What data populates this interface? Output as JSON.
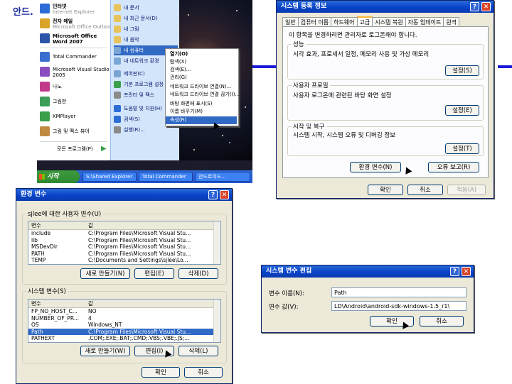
{
  "slide": {
    "title": "안드."
  },
  "start_menu": {
    "left_items": [
      {
        "label": "인터넷",
        "sub": "Internet Explorer",
        "color": "#2b6cd6"
      },
      {
        "label": "전자 메일",
        "sub": "Microsoft Office Outlook",
        "color": "#d9a427"
      },
      {
        "label": "Microsoft Office",
        "sub": "Word 2007",
        "color": "#2a55a8"
      },
      {
        "label": "Total Commander",
        "sub": "",
        "color": "#3a6fd0"
      },
      {
        "label": "Microsoft Visual Studio",
        "sub": "2005",
        "color": "#8a4ec0"
      },
      {
        "label": "나노",
        "sub": "",
        "color": "#c0398a"
      },
      {
        "label": "그림판",
        "sub": "",
        "color": "#3b9d58"
      },
      {
        "label": "KMPlayer",
        "sub": "",
        "color": "#3aa04a"
      },
      {
        "label": "그림 및 팩스 뷰어",
        "sub": "",
        "color": "#c08a40"
      }
    ],
    "all_programs": "모든 프로그램(P)",
    "right_items": [
      {
        "label": "내 문서",
        "color": "#e8c35a"
      },
      {
        "label": "내 최근 문서(D)",
        "color": "#e8c35a"
      },
      {
        "label": "내 그림",
        "color": "#e8c35a"
      },
      {
        "label": "내 음악",
        "color": "#e8c35a"
      },
      {
        "label": "내 컴퓨터",
        "color": "#7aa6d6"
      },
      {
        "label": "내 네트워크 환경",
        "color": "#7aa6d6"
      },
      {
        "label": "제어판(C)",
        "color": "#7aa6d6"
      },
      {
        "label": "기본 프로그램 설정",
        "color": "#3aa04a"
      },
      {
        "label": "프린터 및 팩스",
        "color": "#8a8a8a"
      },
      {
        "label": "도움말 및 지원(H)",
        "color": "#2b6cd6"
      },
      {
        "label": "검색(S)",
        "color": "#2b6cd6"
      },
      {
        "label": "실행(R)...",
        "color": "#8a8a8a"
      }
    ],
    "context_menu": [
      "열기(O)",
      "탐색(X)",
      "검색(E)...",
      "관리(G)",
      "네트워크 드라이브 연결(N)...",
      "네트워크 드라이브 연결 끊기(I)...",
      "바탕 화면에 표시(S)",
      "이름 바꾸기(M)",
      "속성(R)"
    ],
    "taskbar": {
      "start": "시작",
      "items": [
        "S:\\Shared Explorer",
        "Total Commander",
        "안드로이드..."
      ]
    }
  },
  "sysprops": {
    "title": "시스템 등록 정보",
    "tabs": [
      "일반",
      "컴퓨터 이름",
      "하드웨어",
      "고급",
      "시스템 복원",
      "자동 업데이트",
      "원격"
    ],
    "notice": "이 항목을 변경하려면 관리자로 로그온해야 합니다.",
    "groups": [
      {
        "label": "성능",
        "desc": "시각 효과, 프로세서 일정, 메모리 사용 및 가상 메모리",
        "button": "설정(S)"
      },
      {
        "label": "사용자 프로필",
        "desc": "사용자 로그온에 관련된 바탕 화면 설정",
        "button": "설정(E)"
      },
      {
        "label": "시작 및 복구",
        "desc": "시스템 시작, 시스템 오류 및 디버깅 정보",
        "button": "설정(T)"
      }
    ],
    "env_button": "환경 변수(N)",
    "error_button": "오류 보고(R)",
    "ok": "확인",
    "cancel": "취소",
    "apply": "적용(A)"
  },
  "envvars": {
    "title": "환경 변수",
    "user_label": "sjlee에 대한 사용자 변수(U)",
    "columns": [
      "변수",
      "값"
    ],
    "user_vars": [
      {
        "name": "include",
        "value": "C:\\Program Files\\Microsoft Visual Stu..."
      },
      {
        "name": "lib",
        "value": "C:\\Program Files\\Microsoft Visual Stu..."
      },
      {
        "name": "MSDevDir",
        "value": "C:\\Program Files\\Microsoft Visual Stu..."
      },
      {
        "name": "PATH",
        "value": "C:\\Program Files\\Microsoft Visual Stu..."
      },
      {
        "name": "TEMP",
        "value": "C:\\Documents and Settings\\sjlee\\Lo..."
      }
    ],
    "user_buttons": [
      "새로 만들기(N)",
      "편집(E)",
      "삭제(D)"
    ],
    "system_label": "시스템 변수(S)",
    "system_vars": [
      {
        "name": "FP_NO_HOST_C...",
        "value": "NO"
      },
      {
        "name": "NUMBER_OF_PR...",
        "value": "4"
      },
      {
        "name": "OS",
        "value": "Windows_NT"
      },
      {
        "name": "Path",
        "value": "C:\\Program Files\\Microsoft Visual Stu..."
      },
      {
        "name": "PATHEXT",
        "value": ".COM;.EXE;.BAT;.CMD;.VBS;.VBE;.JS;..."
      }
    ],
    "system_buttons": [
      "새로 만들기(W)",
      "편집(I)",
      "삭제(L)"
    ],
    "ok": "확인",
    "cancel": "취소"
  },
  "editvar": {
    "title": "시스템 변수 편집",
    "name_label": "변수 이름(N):",
    "name_value": "Path",
    "value_label": "변수 값(V):",
    "value_value": "LD\\Android\\android-sdk-windows-1.5_r1\\",
    "ok": "확인",
    "cancel": "취소"
  }
}
